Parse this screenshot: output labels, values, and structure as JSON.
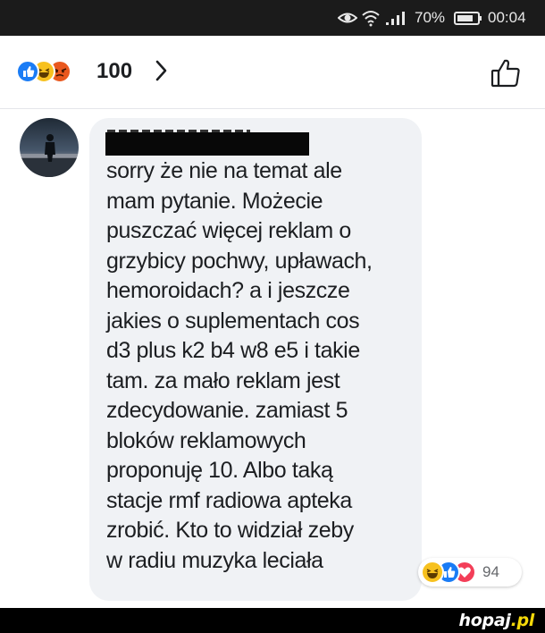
{
  "status_bar": {
    "battery_percent": "70%",
    "time": "00:04",
    "icons": [
      "eye-icon",
      "wifi-icon",
      "signal-icon",
      "battery-icon"
    ]
  },
  "post": {
    "reaction_icons": [
      "like-icon",
      "haha-icon",
      "angry-icon"
    ],
    "reaction_count": "100",
    "like_button_icon": "thumbs-up-outline-icon"
  },
  "comment": {
    "author_redacted": true,
    "lines": [
      "sorry że nie na temat ale",
      "mam pytanie. Możecie",
      "puszczać więcej reklam o",
      "grzybicy pochwy, upławach,",
      "hemoroidach? a i jeszcze",
      "jakies o suplementach cos",
      "d3 plus k2 b4 w8 e5 i takie",
      "tam. za mało reklam jest",
      "zdecydowanie. zamiast 5",
      "bloków reklamowych",
      "proponuję 10. Albo taką",
      "stacje rmf radiowa apteka",
      "zrobić. Kto to widział zeby",
      "w radiu muzyka leciała"
    ],
    "reaction_icons": [
      "haha-icon",
      "like-icon",
      "love-icon"
    ],
    "reaction_count": "94"
  },
  "watermark": {
    "name": "hopaj",
    "tld": ".pl"
  },
  "colors": {
    "status_bar_bg": "#1b1b1b",
    "bubble_bg": "#f0f2f5",
    "like_blue": "#1a7cf5",
    "haha_yellow": "#f7c11f",
    "angry_orange": "#e9581e",
    "love_red": "#f33e58",
    "watermark_accent": "#f5d90a"
  }
}
